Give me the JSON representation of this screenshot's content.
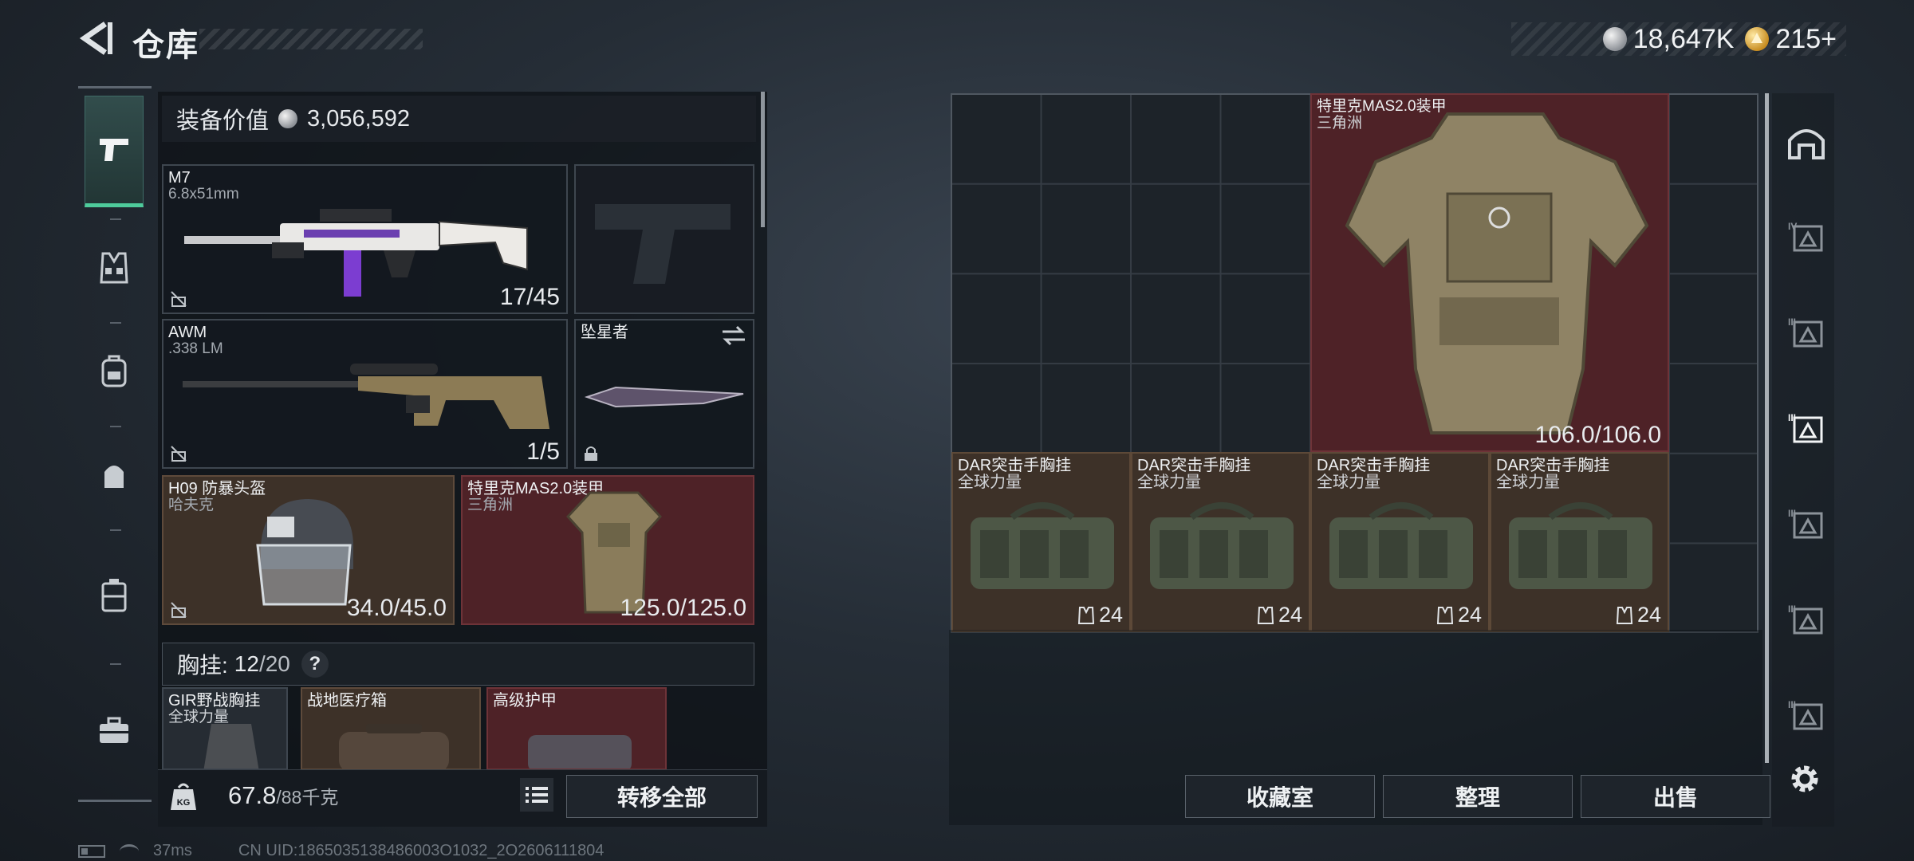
{
  "header": {
    "title": "仓库",
    "currency_silver": "18,647K",
    "currency_gold": "215+"
  },
  "left_panel": {
    "equipment_value_label": "装备价值",
    "equipment_value": "3,056,592",
    "slots": [
      {
        "name": "M7",
        "sub": "6.8x51mm",
        "count": "17/45"
      },
      {
        "name": "",
        "sub": "",
        "count": ""
      },
      {
        "name": "AWM",
        "sub": ".338 LM",
        "count": "1/5"
      },
      {
        "name": "坠星者",
        "sub": "",
        "count": ""
      },
      {
        "name": "H09 防暴头盔",
        "sub": "哈夫克",
        "count": "34.0/45.0"
      },
      {
        "name": "特里克MAS2.0装甲",
        "sub": "三角洲",
        "count": "125.0/125.0"
      }
    ],
    "vest_label": "胸挂:",
    "vest_used": "12",
    "vest_total": "/20",
    "vest_help": "?",
    "rig_items": [
      {
        "name": "GIR野战胸挂",
        "sub": "全球力量"
      },
      {
        "name": "战地医疗箱",
        "sub": ""
      },
      {
        "name": "高级护甲",
        "sub": ""
      }
    ],
    "weight_value": "67.8",
    "weight_cap": "/88千克",
    "transfer_all_label": "转移全部"
  },
  "container": {
    "armor": {
      "name": "特里克MAS2.0装甲",
      "sub": "三角洲",
      "durability": "106.0/106.0"
    },
    "rigs": [
      {
        "name": "DAR突击手胸挂",
        "sub": "全球力量",
        "capacity": "24"
      },
      {
        "name": "DAR突击手胸挂",
        "sub": "全球力量",
        "capacity": "24"
      },
      {
        "name": "DAR突击手胸挂",
        "sub": "全球力量",
        "capacity": "24"
      },
      {
        "name": "DAR突击手胸挂",
        "sub": "全球力量",
        "capacity": "24"
      }
    ],
    "buttons": {
      "collection": "收藏室",
      "organize": "整理",
      "sell": "出售"
    }
  },
  "status_bar": {
    "ping": "37ms",
    "uid": "CN UID:1865035138486003O1032_2O2606111804"
  },
  "colors": {
    "accent_green": "#4ecb9b",
    "slot_red": "#4e2227",
    "slot_brown": "#3d3128"
  }
}
